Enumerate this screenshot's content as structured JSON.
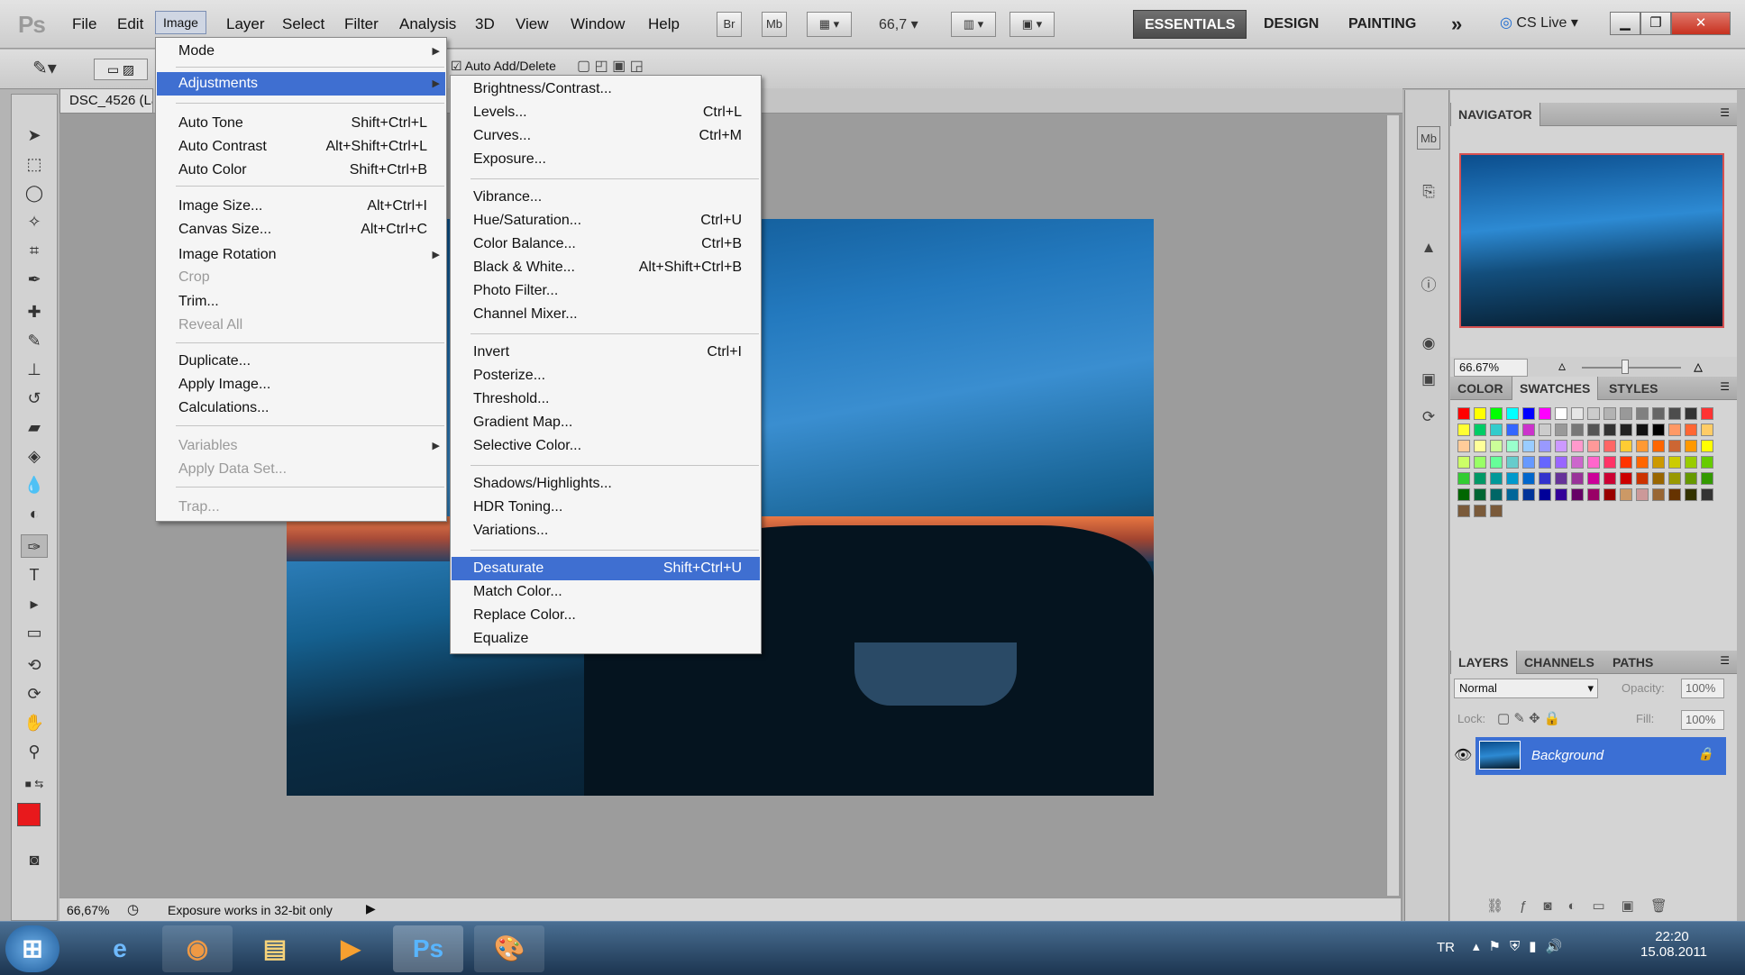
{
  "app": {
    "logo": "Ps"
  },
  "menubar": {
    "items": [
      "File",
      "Edit",
      "Image",
      "Layer",
      "Select",
      "Filter",
      "Analysis",
      "3D",
      "View",
      "Window",
      "Help"
    ],
    "bridge": "Br",
    "mini_bridge": "Mb",
    "zoom": "66,7",
    "workspaces": [
      "ESSENTIALS",
      "DESIGN",
      "PAINTING"
    ],
    "more": "»",
    "cs_live": "CS Live"
  },
  "options": {
    "auto_add_delete": "Auto Add/Delete"
  },
  "document": {
    "tab": "DSC_4526 (La",
    "zoom_status": "66,67%",
    "status_text": "Exposure works in 32-bit only"
  },
  "image_menu": {
    "items": [
      {
        "label": "Mode",
        "submenu": true
      },
      {
        "label": "Adjustments",
        "submenu": true,
        "highlighted": true
      },
      {
        "label": "Auto Tone",
        "shortcut": "Shift+Ctrl+L"
      },
      {
        "label": "Auto Contrast",
        "shortcut": "Alt+Shift+Ctrl+L"
      },
      {
        "label": "Auto Color",
        "shortcut": "Shift+Ctrl+B"
      },
      {
        "label": "Image Size...",
        "shortcut": "Alt+Ctrl+I"
      },
      {
        "label": "Canvas Size...",
        "shortcut": "Alt+Ctrl+C"
      },
      {
        "label": "Image Rotation",
        "submenu": true
      },
      {
        "label": "Crop",
        "disabled": true
      },
      {
        "label": "Trim..."
      },
      {
        "label": "Reveal All",
        "disabled": true
      },
      {
        "label": "Duplicate..."
      },
      {
        "label": "Apply Image..."
      },
      {
        "label": "Calculations..."
      },
      {
        "label": "Variables",
        "submenu": true,
        "disabled": true
      },
      {
        "label": "Apply Data Set...",
        "disabled": true
      },
      {
        "label": "Trap...",
        "disabled": true
      }
    ]
  },
  "adjustments_menu": {
    "items": [
      {
        "label": "Brightness/Contrast..."
      },
      {
        "label": "Levels...",
        "shortcut": "Ctrl+L"
      },
      {
        "label": "Curves...",
        "shortcut": "Ctrl+M"
      },
      {
        "label": "Exposure..."
      },
      {
        "label": "Vibrance..."
      },
      {
        "label": "Hue/Saturation...",
        "shortcut": "Ctrl+U"
      },
      {
        "label": "Color Balance...",
        "shortcut": "Ctrl+B"
      },
      {
        "label": "Black & White...",
        "shortcut": "Alt+Shift+Ctrl+B"
      },
      {
        "label": "Photo Filter..."
      },
      {
        "label": "Channel Mixer..."
      },
      {
        "label": "Invert",
        "shortcut": "Ctrl+I"
      },
      {
        "label": "Posterize..."
      },
      {
        "label": "Threshold..."
      },
      {
        "label": "Gradient Map..."
      },
      {
        "label": "Selective Color..."
      },
      {
        "label": "Shadows/Highlights..."
      },
      {
        "label": "HDR Toning..."
      },
      {
        "label": "Variations..."
      },
      {
        "label": "Desaturate",
        "shortcut": "Shift+Ctrl+U",
        "highlighted": true
      },
      {
        "label": "Match Color..."
      },
      {
        "label": "Replace Color..."
      },
      {
        "label": "Equalize"
      }
    ]
  },
  "navigator": {
    "title": "NAVIGATOR",
    "zoom": "66.67%"
  },
  "color_panel": {
    "tabs": [
      "COLOR",
      "SWATCHES",
      "STYLES"
    ],
    "active": "SWATCHES"
  },
  "layers_panel": {
    "tabs": [
      "LAYERS",
      "CHANNELS",
      "PATHS"
    ],
    "blend_mode": "Normal",
    "opacity_label": "Opacity:",
    "opacity": "100%",
    "lock_label": "Lock:",
    "fill_label": "Fill:",
    "fill": "100%",
    "layer_name": "Background"
  },
  "taskbar": {
    "photoshop_label": "Ps",
    "language": "TR",
    "time": "22:20",
    "date": "15.08.2011"
  },
  "colors": {
    "foreground": "#e8191c",
    "background": "#ffffff",
    "highlight": "#3f6fd1"
  }
}
